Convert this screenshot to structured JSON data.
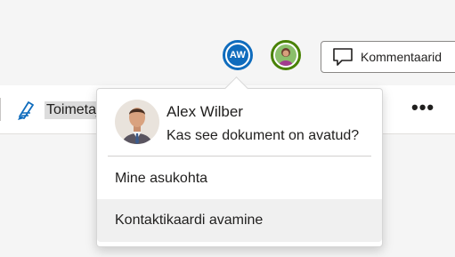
{
  "header": {
    "presence_1": {
      "initials": "AW",
      "ring_color": "#0f6cbd"
    },
    "presence_2": {
      "ring_color": "#498205"
    },
    "comments_button": {
      "label": "Kommentaarid",
      "icon": "comment-icon"
    }
  },
  "ribbon": {
    "editor": {
      "label": "Toimetaja",
      "icon": "editor-pen-icon"
    },
    "more_label": "•••"
  },
  "flyout": {
    "person": {
      "name": "Alex Wilber",
      "question": "Kas see dokument on avatud?",
      "avatar": "profile-photo"
    },
    "items": [
      {
        "label": "Mine asukohta"
      },
      {
        "label": "Kontaktikaardi avamine"
      }
    ]
  },
  "colors": {
    "accent": "#0f6cbd",
    "presence_green": "#498205"
  }
}
